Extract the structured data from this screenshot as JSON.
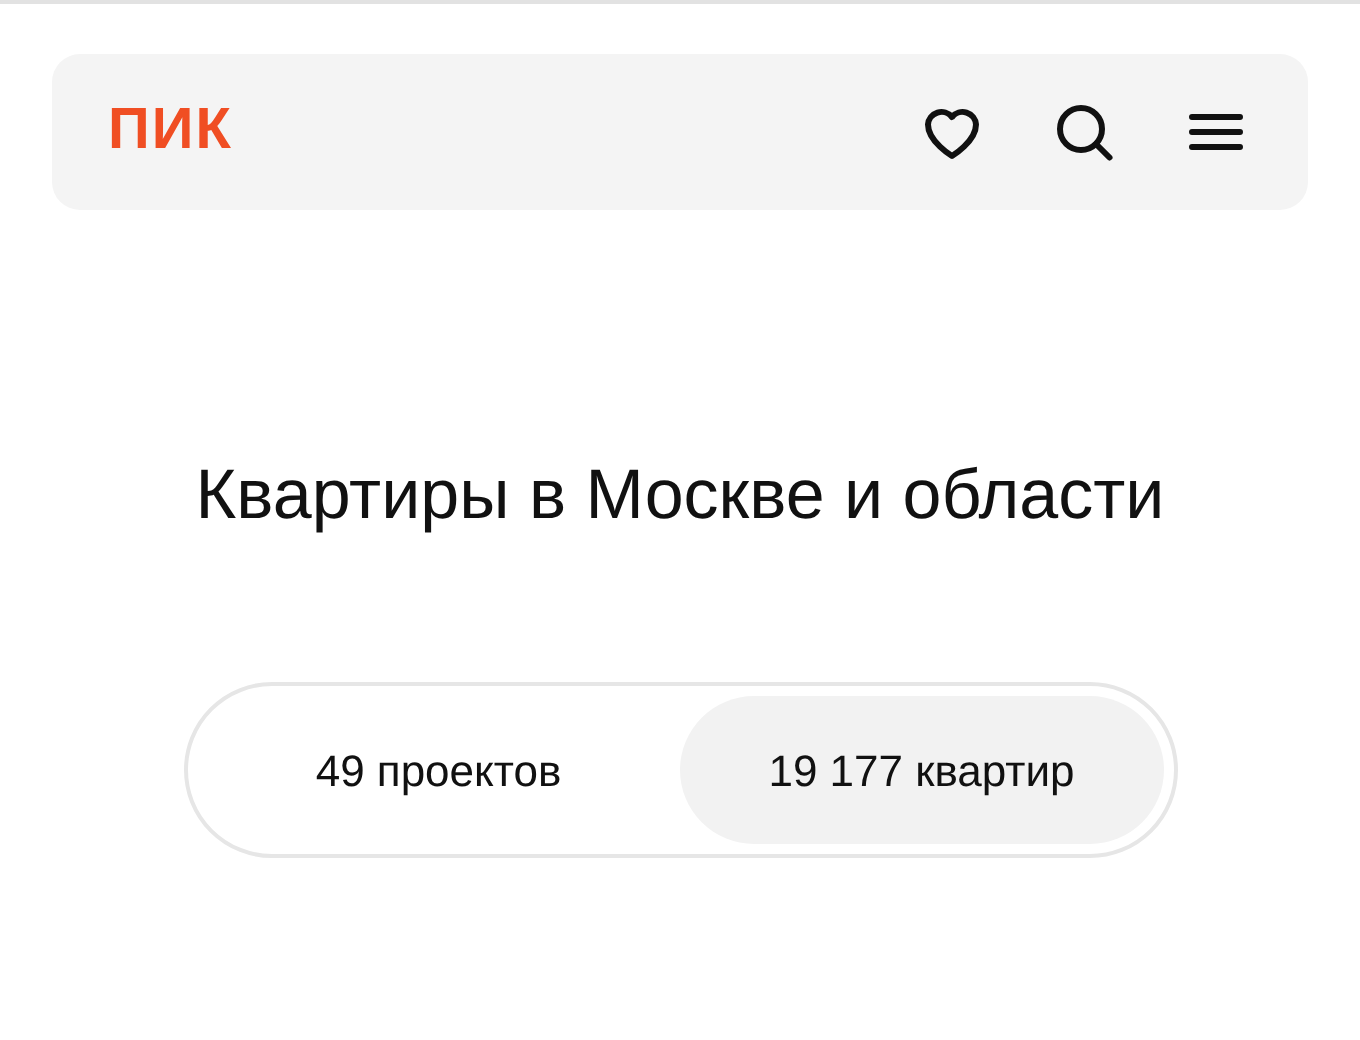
{
  "header": {
    "logo": "ПИК"
  },
  "title": "Квартиры в Москве и области",
  "segments": [
    {
      "label": "49 проектов",
      "selected": false
    },
    {
      "label": "19 177 квартир",
      "selected": true
    }
  ]
}
